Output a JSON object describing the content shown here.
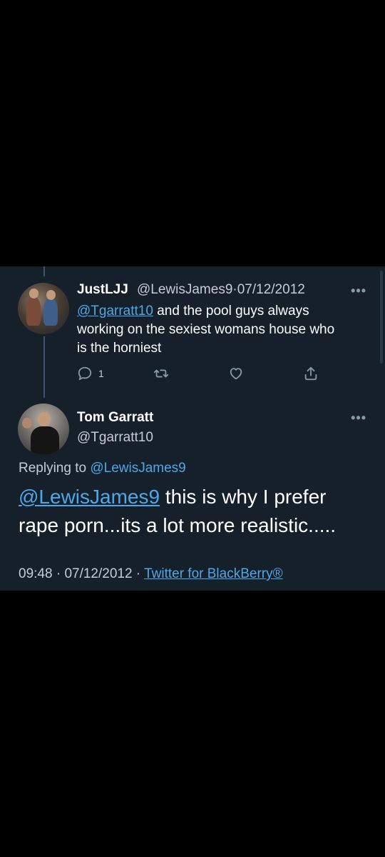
{
  "parent_tweet": {
    "display_name": "JustLJJ",
    "handle": "@LewisJames9",
    "separator": "·",
    "date": "07/12/2012",
    "mention": "@Tgarratt10",
    "text_line1_rest": " and the pool guys always",
    "text_line2": "working on the sexiest womans house who",
    "text_line3": "is the horniest",
    "reply_count": "1",
    "icons": [
      "reply-icon",
      "retweet-icon",
      "like-icon",
      "share-icon"
    ]
  },
  "reply_tweet": {
    "display_name": "Tom Garratt",
    "handle": "@Tgarratt10",
    "replying_to_label": "Replying to ",
    "replying_to_handle": "@LewisJames9",
    "mention": "@LewisJames9",
    "text_line1_rest": " this is why I prefer",
    "text_line2": "rape porn...its a lot more realistic.....",
    "time": "09:48",
    "footer_sep1": " · ",
    "date": "07/12/2012",
    "footer_sep2": " · ",
    "source": "Twitter for BlackBerry®"
  },
  "more_glyph": "•••",
  "colors": {
    "background": "#000000",
    "panel": "#15202b",
    "link": "#4ea8e8",
    "secondary_text": "#c5ccd3",
    "icon": "#8899a6"
  }
}
